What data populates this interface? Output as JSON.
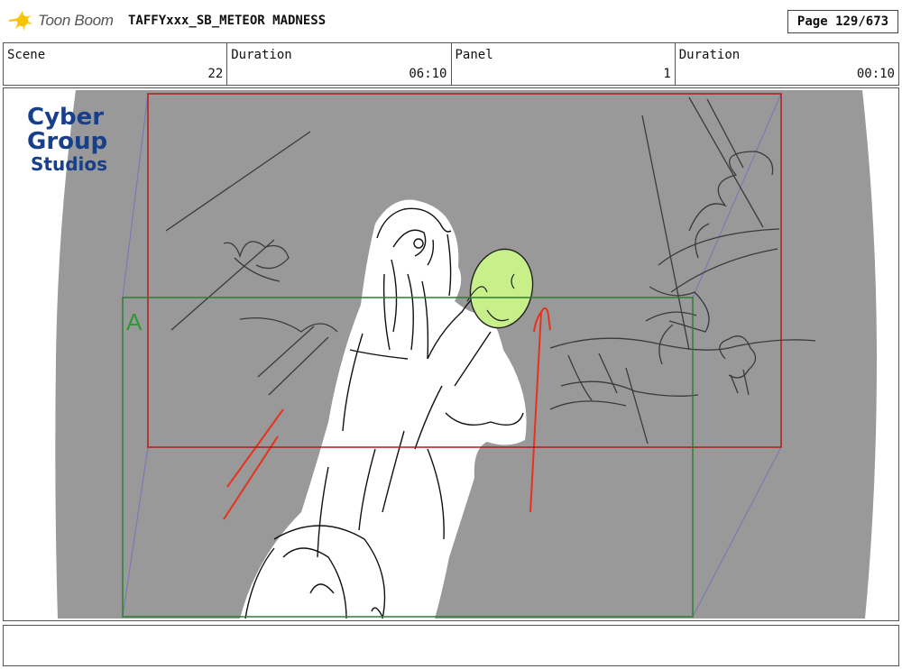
{
  "header": {
    "app_name": "Toon Boom",
    "doc_title": "TAFFYxxx_SB_METEOR MADNESS",
    "page": "Page 129/673"
  },
  "info": {
    "scene_label": "Scene",
    "scene_value": "22",
    "duration_label": "Duration",
    "scene_duration": "06:10",
    "panel_label": "Panel",
    "panel_value": "1",
    "panel_duration_label": "Duration",
    "panel_duration": "00:10"
  },
  "panel": {
    "studio_logo_lines": [
      "Cyber",
      "Group",
      "Studios"
    ],
    "field_label": "A",
    "colors": {
      "background": "#999999",
      "camera_frame": "#b01c1c",
      "field_frame": "#2e7d32",
      "highlight": "#c8f08a",
      "action_lines": "#e8301c",
      "logo_blue": "#173f8a"
    }
  },
  "caption": {
    "text": ""
  }
}
